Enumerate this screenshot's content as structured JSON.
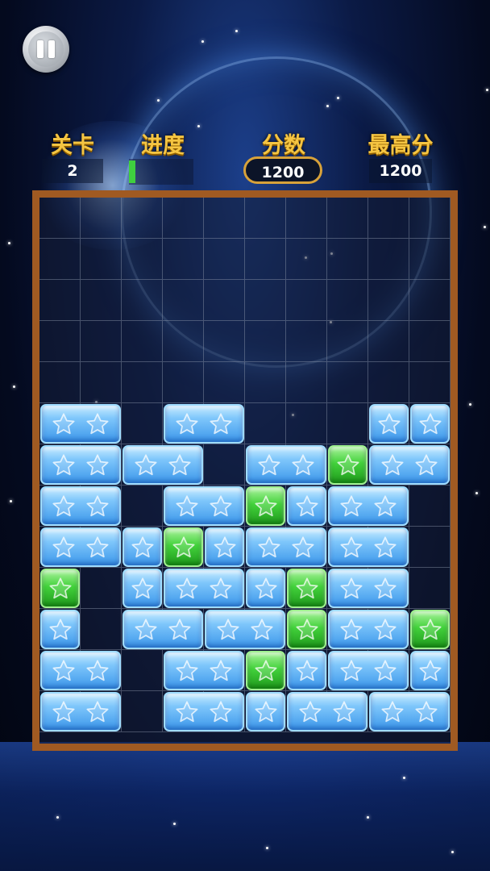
{
  "hud": {
    "level_label": "关卡",
    "level_value": "2",
    "progress_label": "进度",
    "progress_fraction": 0.1,
    "score_label": "分数",
    "score_value": "1200",
    "best_label": "最高分",
    "best_value": "1200"
  },
  "icons": {
    "pause": "pause-icon",
    "block_star": "star-icon"
  },
  "colors": {
    "label_gold": "#f5c542",
    "frame_brown": "#a05a22",
    "progress_green": "#3fcf3f",
    "block_blue": "#7ec6fb",
    "block_green": "#43d23c"
  },
  "board": {
    "columns": 10,
    "rows": 13,
    "blocks": [
      {
        "row": 5,
        "col": 0,
        "span": 2,
        "color": "blue"
      },
      {
        "row": 5,
        "col": 3,
        "span": 2,
        "color": "blue"
      },
      {
        "row": 5,
        "col": 8,
        "span": 1,
        "color": "blue"
      },
      {
        "row": 5,
        "col": 9,
        "span": 1,
        "color": "blue"
      },
      {
        "row": 6,
        "col": 0,
        "span": 2,
        "color": "blue"
      },
      {
        "row": 6,
        "col": 2,
        "span": 2,
        "color": "blue"
      },
      {
        "row": 6,
        "col": 5,
        "span": 2,
        "color": "blue"
      },
      {
        "row": 6,
        "col": 7,
        "span": 1,
        "color": "green"
      },
      {
        "row": 6,
        "col": 8,
        "span": 2,
        "color": "blue"
      },
      {
        "row": 7,
        "col": 0,
        "span": 2,
        "color": "blue"
      },
      {
        "row": 7,
        "col": 3,
        "span": 2,
        "color": "blue"
      },
      {
        "row": 7,
        "col": 5,
        "span": 1,
        "color": "green"
      },
      {
        "row": 7,
        "col": 6,
        "span": 1,
        "color": "blue"
      },
      {
        "row": 7,
        "col": 7,
        "span": 2,
        "color": "blue"
      },
      {
        "row": 8,
        "col": 0,
        "span": 2,
        "color": "blue"
      },
      {
        "row": 8,
        "col": 2,
        "span": 1,
        "color": "blue"
      },
      {
        "row": 8,
        "col": 3,
        "span": 1,
        "color": "green"
      },
      {
        "row": 8,
        "col": 4,
        "span": 1,
        "color": "blue"
      },
      {
        "row": 8,
        "col": 5,
        "span": 2,
        "color": "blue"
      },
      {
        "row": 8,
        "col": 7,
        "span": 2,
        "color": "blue"
      },
      {
        "row": 9,
        "col": 0,
        "span": 1,
        "color": "green"
      },
      {
        "row": 9,
        "col": 2,
        "span": 1,
        "color": "blue"
      },
      {
        "row": 9,
        "col": 3,
        "span": 2,
        "color": "blue"
      },
      {
        "row": 9,
        "col": 5,
        "span": 1,
        "color": "blue"
      },
      {
        "row": 9,
        "col": 6,
        "span": 1,
        "color": "green"
      },
      {
        "row": 9,
        "col": 7,
        "span": 2,
        "color": "blue"
      },
      {
        "row": 10,
        "col": 0,
        "span": 1,
        "color": "blue"
      },
      {
        "row": 10,
        "col": 2,
        "span": 2,
        "color": "blue"
      },
      {
        "row": 10,
        "col": 4,
        "span": 2,
        "color": "blue"
      },
      {
        "row": 10,
        "col": 6,
        "span": 1,
        "color": "green"
      },
      {
        "row": 10,
        "col": 7,
        "span": 2,
        "color": "blue"
      },
      {
        "row": 10,
        "col": 9,
        "span": 1,
        "color": "green"
      },
      {
        "row": 11,
        "col": 0,
        "span": 2,
        "color": "blue"
      },
      {
        "row": 11,
        "col": 3,
        "span": 2,
        "color": "blue"
      },
      {
        "row": 11,
        "col": 5,
        "span": 1,
        "color": "green"
      },
      {
        "row": 11,
        "col": 6,
        "span": 1,
        "color": "blue"
      },
      {
        "row": 11,
        "col": 7,
        "span": 2,
        "color": "blue"
      },
      {
        "row": 11,
        "col": 9,
        "span": 1,
        "color": "blue"
      },
      {
        "row": 12,
        "col": 0,
        "span": 2,
        "color": "blue"
      },
      {
        "row": 12,
        "col": 3,
        "span": 2,
        "color": "blue"
      },
      {
        "row": 12,
        "col": 5,
        "span": 1,
        "color": "blue"
      },
      {
        "row": 12,
        "col": 6,
        "span": 2,
        "color": "blue"
      },
      {
        "row": 12,
        "col": 8,
        "span": 2,
        "color": "blue"
      }
    ]
  }
}
